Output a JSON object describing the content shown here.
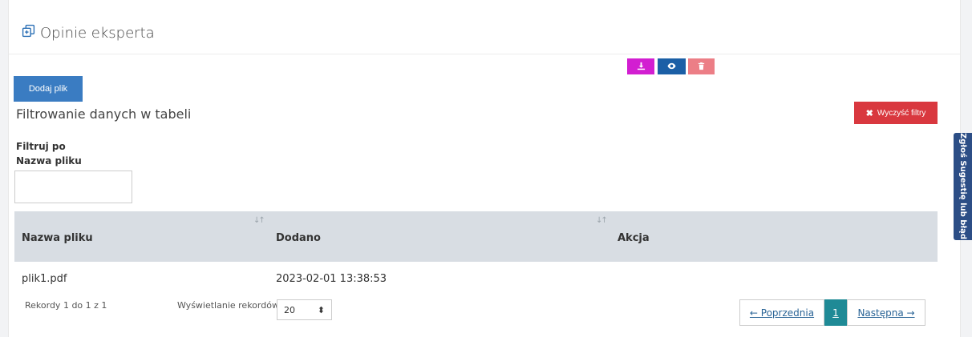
{
  "header": {
    "title": "Opinie eksperta"
  },
  "toolbar": {
    "add_label": "Dodaj plik"
  },
  "filter": {
    "title": "Filtrowanie danych w tabeli",
    "clear_label": "Wyczyść filtry",
    "by_label": "Filtruj po",
    "field_label": "Nazwa pliku",
    "field_value": ""
  },
  "table": {
    "columns": [
      "Nazwa pliku",
      "Dodano",
      "Akcja"
    ],
    "rows": [
      {
        "name": "plik1.pdf",
        "added": "2023-02-01 13:38:53"
      }
    ],
    "actions": [
      {
        "icon": "download-icon",
        "color": "#d21ed1"
      },
      {
        "icon": "eye-icon",
        "color": "#1b5fa6"
      },
      {
        "icon": "trash-icon",
        "color": "#ec7e86"
      }
    ]
  },
  "footer": {
    "records": "Rekordy 1 do 1 z 1",
    "show_label": "Wyświetlanie rekordów",
    "page_size": "20",
    "prev_label": "← Poprzednia",
    "current_page": "1",
    "next_label": "Następna →"
  },
  "side_tab": {
    "label": "Zgłoś Sugestię lub błąd"
  }
}
